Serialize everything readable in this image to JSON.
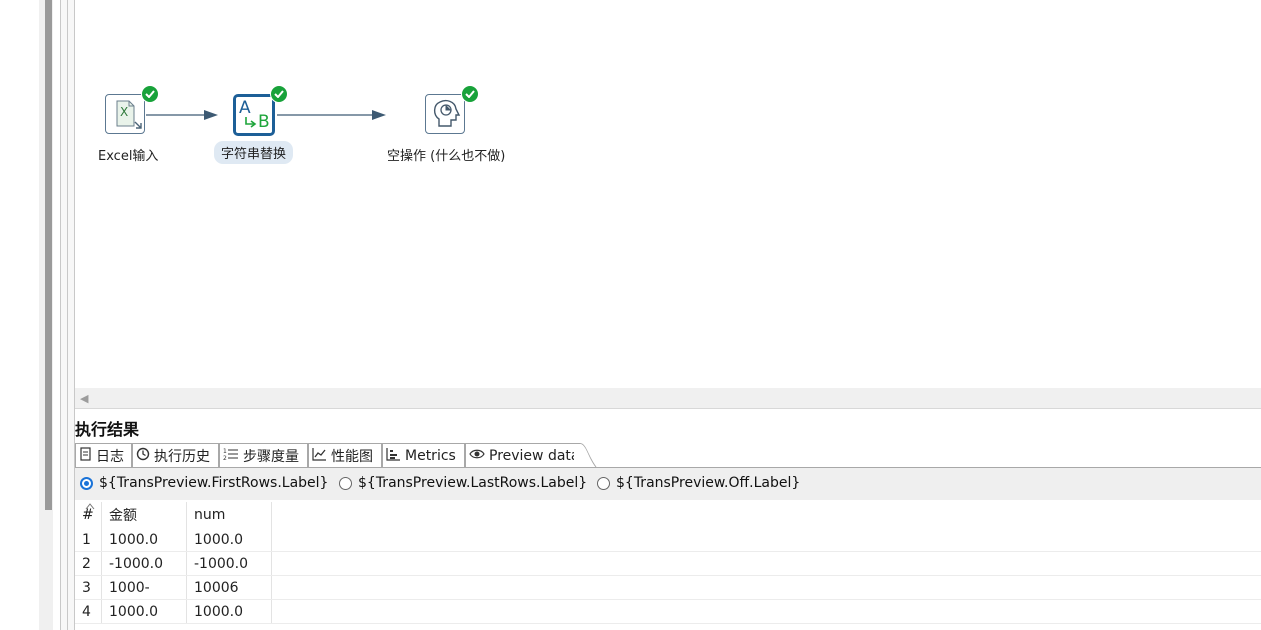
{
  "steps": [
    {
      "label": "Excel输入",
      "icon": "excel-input-icon",
      "status": "success"
    },
    {
      "label": "字符串替换",
      "icon": "string-replace-icon",
      "status": "success",
      "selected": true
    },
    {
      "label": "空操作 (什么也不做)",
      "icon": "dummy-step-icon",
      "status": "success"
    }
  ],
  "step_icon_text": {
    "replace_a": "A",
    "replace_b": "B",
    "excel_x": "X"
  },
  "results": {
    "title": "执行结果",
    "tabs": [
      {
        "label": "日志",
        "icon": "log-icon"
      },
      {
        "label": "执行历史",
        "icon": "history-icon"
      },
      {
        "label": "步骤度量",
        "icon": "step-metrics-icon"
      },
      {
        "label": "性能图",
        "icon": "performance-graph-icon"
      },
      {
        "label": "Metrics",
        "icon": "metrics-icon"
      },
      {
        "label": "Preview data",
        "icon": "eye-icon",
        "active": true
      }
    ],
    "preview_options": [
      {
        "label": "${TransPreview.FirstRows.Label}",
        "selected": true
      },
      {
        "label": "${TransPreview.LastRows.Label}",
        "selected": false
      },
      {
        "label": "${TransPreview.Off.Label}",
        "selected": false
      }
    ],
    "table": {
      "columns": [
        "#",
        "金额",
        "num"
      ],
      "rows": [
        [
          "1",
          "1000.0",
          "1000.0"
        ],
        [
          "2",
          "-1000.0",
          "-1000.0"
        ],
        [
          "3",
          "1000-",
          "10006"
        ],
        [
          "4",
          "1000.0",
          "1000.0"
        ]
      ]
    }
  },
  "colors": {
    "success": "#18a23a",
    "selected_border": "#1d5f97",
    "hop": "#3d5a73",
    "radio_on": "#1a73d8"
  }
}
